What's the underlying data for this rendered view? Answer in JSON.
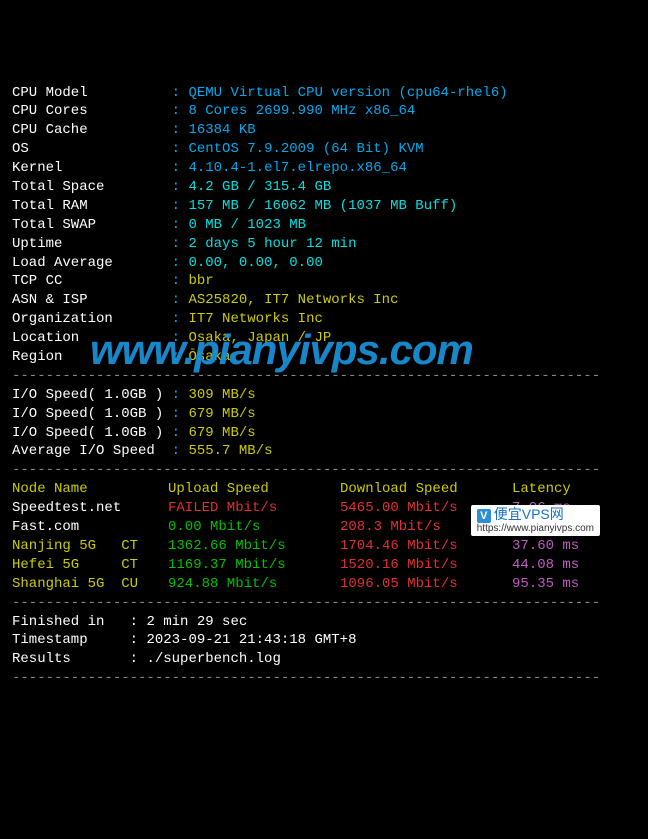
{
  "info": [
    {
      "label": "CPU Model",
      "value": "QEMU Virtual CPU version (cpu64-rhel6)",
      "cls": "val-blue"
    },
    {
      "label": "CPU Cores",
      "value": "8 Cores 2699.990 MHz x86_64",
      "cls": "val-blue"
    },
    {
      "label": "CPU Cache",
      "value": "16384 KB",
      "cls": "val-blue"
    },
    {
      "label": "OS",
      "value": "CentOS 7.9.2009 (64 Bit) KVM",
      "cls": "val-blue"
    },
    {
      "label": "Kernel",
      "value": "4.10.4-1.el7.elrepo.x86_64",
      "cls": "val-blue"
    },
    {
      "label": "Total Space",
      "value": "4.2 GB / 315.4 GB",
      "cls": "val-cyan"
    },
    {
      "label": "Total RAM",
      "value": "157 MB / 16062 MB (1037 MB Buff)",
      "cls": "val-cyan"
    },
    {
      "label": "Total SWAP",
      "value": "0 MB / 1023 MB",
      "cls": "val-cyan"
    },
    {
      "label": "Uptime",
      "value": "2 days 5 hour 12 min",
      "cls": "val-cyan"
    },
    {
      "label": "Load Average",
      "value": "0.00, 0.00, 0.00",
      "cls": "val-cyan"
    },
    {
      "label": "TCP CC",
      "value": "bbr",
      "cls": "val-yellow"
    },
    {
      "label": "ASN & ISP",
      "value": "AS25820, IT7 Networks Inc",
      "cls": "val-yellow"
    },
    {
      "label": "Organization",
      "value": "IT7 Networks Inc",
      "cls": "val-yellow"
    },
    {
      "label": "Location",
      "value": "Osaka, Japan / JP",
      "cls": "val-yellow"
    },
    {
      "label": "Region",
      "value": "Ōsaka",
      "cls": "val-yellow"
    }
  ],
  "io": [
    {
      "label": "I/O Speed( 1.0GB )",
      "value": "309 MB/s"
    },
    {
      "label": "I/O Speed( 1.0GB )",
      "value": "679 MB/s"
    },
    {
      "label": "I/O Speed( 1.0GB )",
      "value": "679 MB/s"
    },
    {
      "label": "Average I/O Speed",
      "value": "555.7 MB/s"
    }
  ],
  "speed_header": {
    "node": "Node Name",
    "up": "Upload Speed",
    "down": "Download Speed",
    "lat": "Latency"
  },
  "speed": [
    {
      "node": "Speedtest.net",
      "node_cls": "white",
      "prov": "",
      "up": "FAILED Mbit/s",
      "up_cls": "val-red",
      "down": "5465.00 Mbit/s",
      "down_cls": "val-red",
      "lat": "7.06 ms"
    },
    {
      "node": "Fast.com",
      "node_cls": "white",
      "prov": "",
      "up": "0.00 Mbit/s",
      "up_cls": "val-green",
      "down": "208.3 Mbit/s",
      "down_cls": "val-red",
      "lat": "-"
    },
    {
      "node": "Nanjing 5G",
      "node_cls": "val-yellow",
      "prov": "CT",
      "up": "1362.66 Mbit/s",
      "up_cls": "val-green",
      "down": "1704.46 Mbit/s",
      "down_cls": "val-red",
      "lat": "37.60 ms"
    },
    {
      "node": "Hefei 5G",
      "node_cls": "val-yellow",
      "prov": "CT",
      "up": "1169.37 Mbit/s",
      "up_cls": "val-green",
      "down": "1520.16 Mbit/s",
      "down_cls": "val-red",
      "lat": "44.08 ms"
    },
    {
      "node": "Shanghai 5G",
      "node_cls": "val-yellow",
      "prov": "CU",
      "up": "924.88 Mbit/s",
      "up_cls": "val-green",
      "down": "1096.05 Mbit/s",
      "down_cls": "val-red",
      "lat": "95.35 ms"
    }
  ],
  "footer": [
    {
      "label": "Finished in",
      "value": "2 min 29 sec"
    },
    {
      "label": "Timestamp",
      "value": "2023-09-21 21:43:18 GMT+8"
    },
    {
      "label": "Results",
      "value": "./superbench.log"
    }
  ],
  "hr": "----------------------------------------------------------------------",
  "watermark": "www.pianyivps.com",
  "badge": {
    "title": "便宜VPS网",
    "url": "https://www.pianyivps.com"
  }
}
